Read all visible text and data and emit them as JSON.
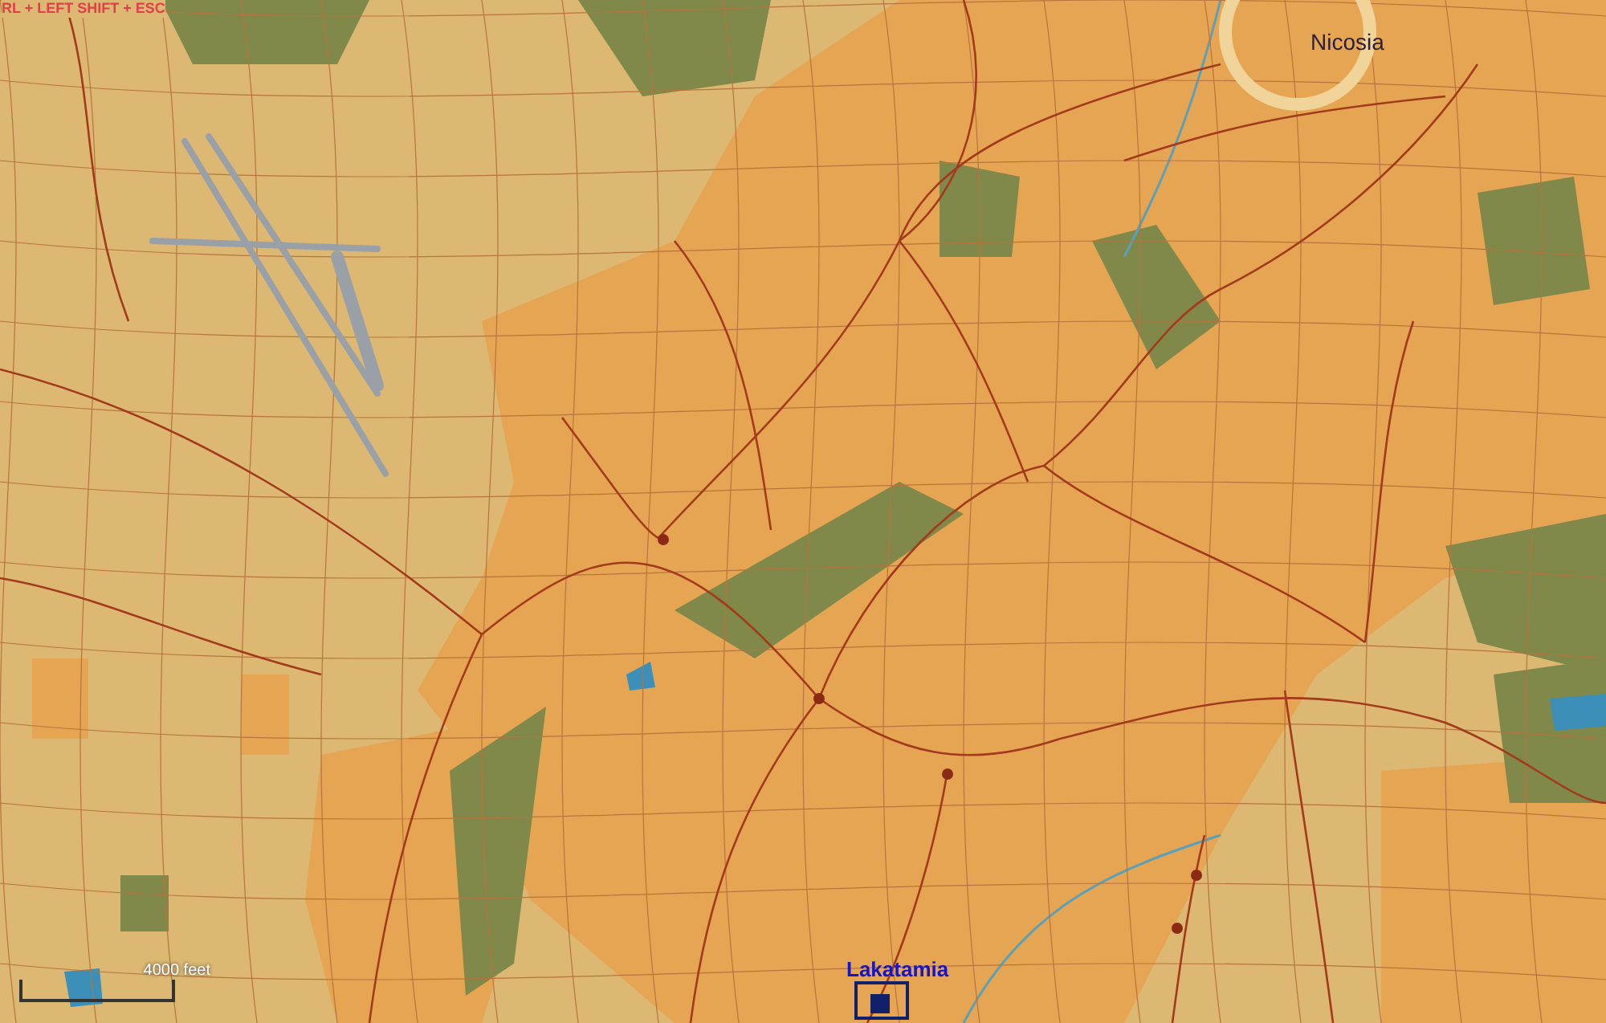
{
  "hint": "RL + LEFT SHIFT + ESC",
  "places": [
    {
      "name": "Nicosia",
      "kind": "city"
    },
    {
      "name": "Lakatamia",
      "kind": "airfield"
    }
  ],
  "scale_bar": {
    "label": "4000 feet"
  }
}
